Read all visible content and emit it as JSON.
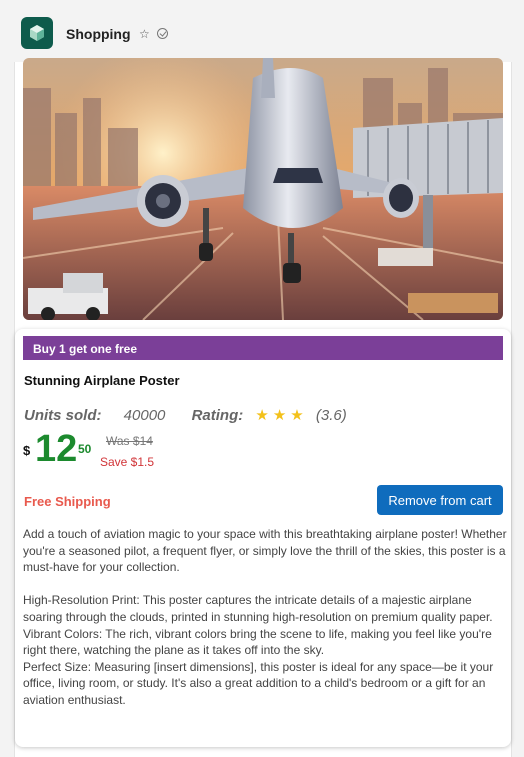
{
  "header": {
    "title": "Shopping"
  },
  "product": {
    "promo": "Buy 1 get one free",
    "title": "Stunning Airplane Poster",
    "units_sold_label": "Units sold:",
    "units_sold": "40000",
    "rating_label": "Rating:",
    "rating_stars": "★★★",
    "rating_value": "(3.6)",
    "rating": 3.6,
    "currency": "$",
    "price_whole": "12",
    "price_cents": "50",
    "was": "Was $14",
    "save": "Save $1.5",
    "shipping": "Free Shipping",
    "cart_button": "Remove from cart",
    "description": {
      "intro": "Add a touch of aviation magic to your space with this breathtaking airplane poster! Whether you're a seasoned pilot, a frequent flyer, or simply love the thrill of the skies, this poster is a must-have for your collection.",
      "f1": "High-Resolution Print: This poster captures the intricate details of a majestic airplane soaring through the clouds, printed in stunning high-resolution on premium quality paper.",
      "f2": "Vibrant Colors: The rich, vibrant colors bring the scene to life, making you feel like you're right there, watching the plane as it takes off into the sky.",
      "f3": "Perfect Size: Measuring [insert dimensions], this poster is ideal for any space—be it your office, living room, or study. It's also a great addition to a child's bedroom or a gift for an aviation enthusiast."
    }
  },
  "colors": {
    "promo": "#7b3f98",
    "price": "#1c8a2e",
    "save": "#d13438",
    "shipping": "#e8594d",
    "button": "#0f6cbd",
    "stars": "#f3c11a"
  }
}
